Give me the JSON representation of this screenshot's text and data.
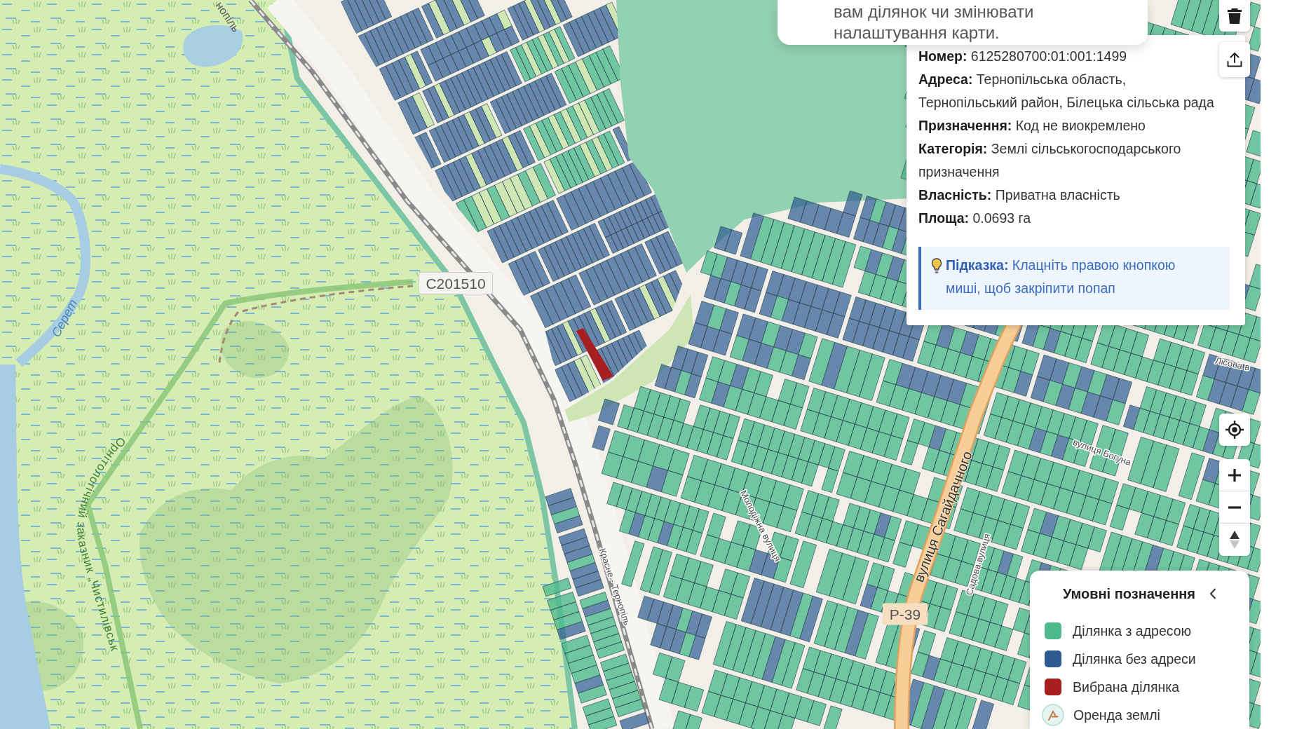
{
  "notice": {
    "text": "вам ділянок чи змінювати налаштування карти."
  },
  "parcel_popup": {
    "fields": [
      "**Номер:** 6125280700:01:001:1499",
      "**Адреса:** Тернопільська область, Тернопільський район, Білецька сільська рада",
      "**Призначення:** Код не виокремлено",
      "**Категорія:** Землі сільськогосподарського призначення",
      "**Власність:** Приватна власність",
      "**Площа:** 0.0693 га"
    ],
    "hint": "**Підказка:** Клацніть правою кнопкою миші, щоб закріпити попап"
  },
  "map": {
    "labels": [
      {
        "kind": "road_ref",
        "text": "С201510"
      },
      {
        "kind": "water",
        "text": "Серет"
      },
      {
        "kind": "place",
        "text": "нопіль"
      },
      {
        "kind": "area",
        "text": "Орнітологічний заказник „Чистилівськ"
      },
      {
        "kind": "street",
        "text": "Красне - Тернопіль"
      },
      {
        "kind": "street",
        "text": "Молодіжна вулиця"
      },
      {
        "kind": "street",
        "text": "вулиця Богуна"
      },
      {
        "kind": "street",
        "text": "Лісова в"
      },
      {
        "kind": "main_street",
        "text": "вулиця Сагайдачного"
      },
      {
        "kind": "street",
        "text": "Садова вулиця"
      },
      {
        "kind": "road_ref",
        "text": "Р-39"
      }
    ]
  },
  "legend": {
    "title": "Умовні позначення",
    "expanded": true,
    "items": [
      {
        "kind": "swatch",
        "label": "Ділянка з адресою",
        "color": "#4cba8d"
      },
      {
        "kind": "swatch",
        "label": "Ділянка без адреси",
        "color": "#2c5b92"
      },
      {
        "kind": "swatch",
        "label": "Вибрана ділянка",
        "color": "#a81f22"
      },
      {
        "kind": "marker",
        "label": "Оренда землі"
      }
    ]
  }
}
